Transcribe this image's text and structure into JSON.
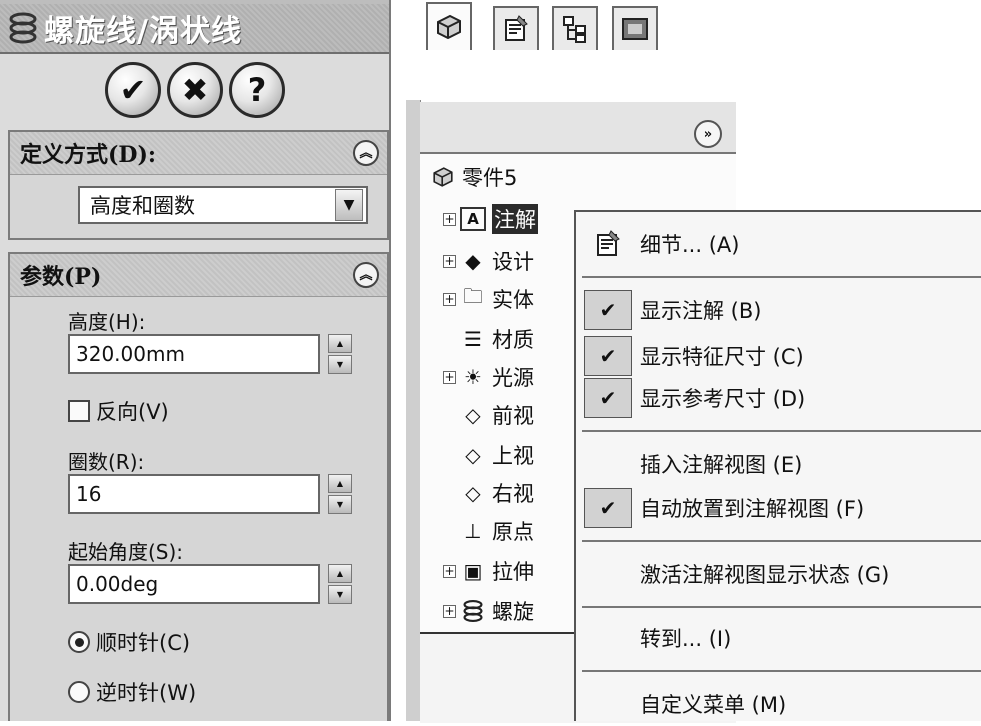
{
  "pm": {
    "title": "螺旋线/涡状线",
    "ok_icon": "✔",
    "cancel_icon": "✖",
    "help_icon": "?",
    "define": {
      "title": "定义方式(D):",
      "value": "高度和圈数",
      "arrow": "▼"
    },
    "params": {
      "title": "参数(P)",
      "height_label": "高度(H):",
      "height_value": "320.00mm",
      "reverse_label": "反向(V)",
      "turns_label": "圈数(R):",
      "turns_value": "16",
      "start_angle_label": "起始角度(S):",
      "start_angle_value": "0.00deg",
      "clockwise_label": "顺时针(C)",
      "counterclockwise_label": "逆时针(W)"
    },
    "collapse_icon": "︽"
  },
  "fm": {
    "more_icon": "»",
    "root_label": "零件5",
    "items": [
      {
        "label": "注解",
        "expander": "+"
      },
      {
        "label": "设计",
        "expander": "+"
      },
      {
        "label": "实体",
        "expander": "+"
      },
      {
        "label": "材质",
        "expander": ""
      },
      {
        "label": "光源",
        "expander": "+"
      },
      {
        "label": "前视",
        "expander": ""
      },
      {
        "label": "上视",
        "expander": ""
      },
      {
        "label": "右视",
        "expander": ""
      },
      {
        "label": "原点",
        "expander": ""
      },
      {
        "label": "拉伸",
        "expander": "+"
      },
      {
        "label": "螺旋",
        "expander": "+"
      }
    ]
  },
  "ctx": {
    "items": [
      {
        "label": "细节...  (A)"
      },
      {
        "label": "显示注解  (B)",
        "checked": true
      },
      {
        "label": "显示特征尺寸  (C)",
        "checked": true
      },
      {
        "label": "显示参考尺寸  (D)",
        "checked": true
      },
      {
        "label": "插入注解视图  (E)"
      },
      {
        "label": "自动放置到注解视图  (F)",
        "checked": true
      },
      {
        "label": "激活注解视图显示状态  (G)"
      },
      {
        "label": "转到...  (I)"
      },
      {
        "label": "自定义菜单 (M)"
      }
    ],
    "check_glyph": "✔"
  }
}
